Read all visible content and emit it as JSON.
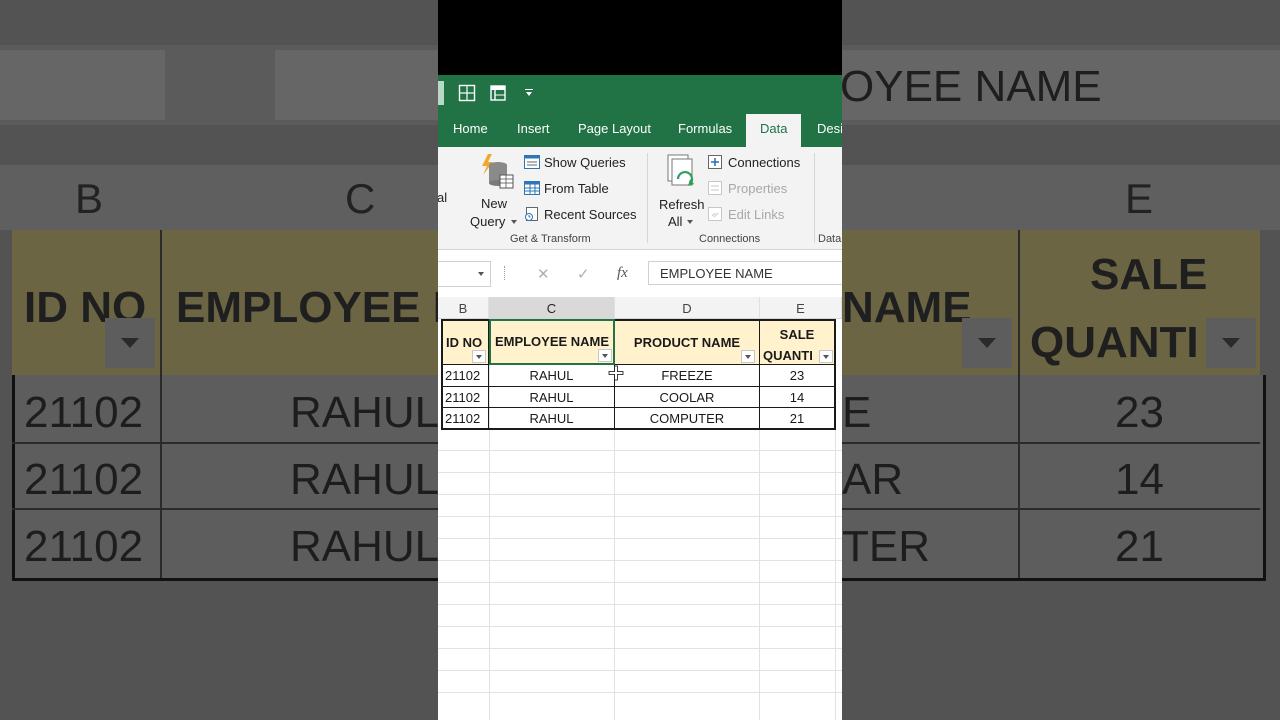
{
  "background_zoom": {
    "formula_text": "OYEE NAME",
    "columns": [
      "B",
      "C",
      "E"
    ],
    "headers": [
      "ID NO",
      "EMPLOYEE N",
      "NAME",
      "SALE",
      "QUANTI"
    ],
    "rows": [
      [
        "21102",
        "RAHUL",
        "E",
        "23"
      ],
      [
        "21102",
        "RAHUL",
        "AR",
        "14"
      ],
      [
        "21102",
        "RAHUL",
        "TER",
        "21"
      ]
    ]
  },
  "ribbon": {
    "tabs": [
      "Home",
      "Insert",
      "Page Layout",
      "Formulas",
      "Data",
      "Desi"
    ],
    "active_tab": "Data",
    "left_cut_label": "al",
    "get_transform": {
      "new_query_line1": "New",
      "new_query_line2": "Query",
      "show_queries": "Show Queries",
      "from_table": "From Table",
      "recent_sources": "Recent Sources",
      "group_label": "Get & Transform"
    },
    "connections": {
      "refresh_line1": "Refresh",
      "refresh_line2": "All",
      "connections": "Connections",
      "properties": "Properties",
      "edit_links": "Edit Links",
      "group_label": "Connections"
    },
    "next_group_label": "Data"
  },
  "formula_bar": {
    "cancel_glyph": "✕",
    "enter_glyph": "✓",
    "fx_glyph": "fx",
    "content": "EMPLOYEE NAME"
  },
  "sheet": {
    "columns": [
      "B",
      "C",
      "D",
      "E"
    ],
    "header": {
      "id": "ID NO",
      "employee": "EMPLOYEE NAME",
      "product": "PRODUCT NAME",
      "sale_line1": "SALE",
      "sale_line2": "QUANTI"
    },
    "rows": [
      {
        "id": "21102",
        "employee": "RAHUL",
        "product": "FREEZE",
        "qty": "23"
      },
      {
        "id": "21102",
        "employee": "RAHUL",
        "product": "COOLAR",
        "qty": "14"
      },
      {
        "id": "21102",
        "employee": "RAHUL",
        "product": "COMPUTER",
        "qty": "21"
      }
    ]
  },
  "colors": {
    "excel_green": "#217346",
    "header_fill": "#fff2cc"
  }
}
